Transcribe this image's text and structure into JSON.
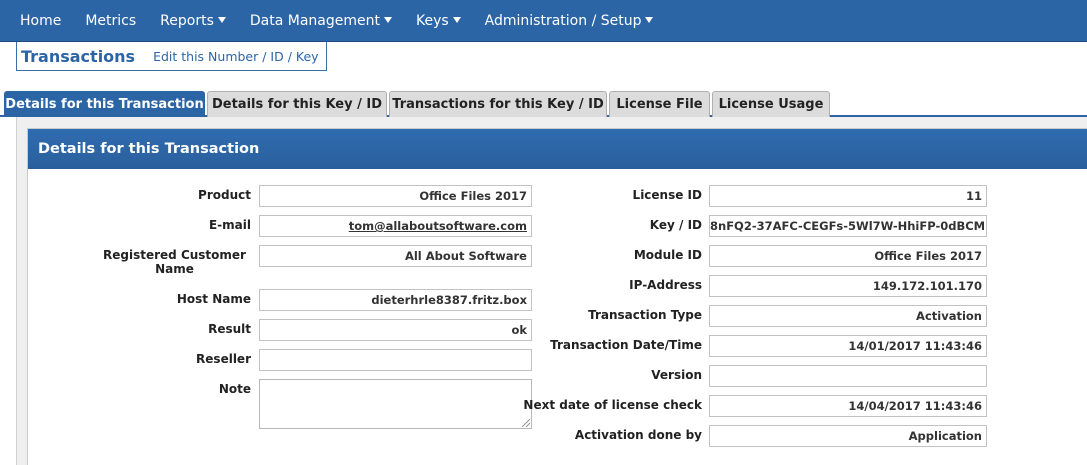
{
  "nav": {
    "items": [
      {
        "label": "Home",
        "dropdown": false
      },
      {
        "label": "Metrics",
        "dropdown": false
      },
      {
        "label": "Reports",
        "dropdown": true
      },
      {
        "label": "Data Management",
        "dropdown": true
      },
      {
        "label": "Keys",
        "dropdown": true
      },
      {
        "label": "Administration / Setup",
        "dropdown": true
      }
    ]
  },
  "header": {
    "title": "Transactions",
    "edit_link": "Edit this Number / ID / Key"
  },
  "tabs": [
    {
      "label": "Details for this Transaction",
      "active": true
    },
    {
      "label": "Details for this Key / ID",
      "active": false
    },
    {
      "label": "Transactions for this Key / ID",
      "active": false
    },
    {
      "label": "License File",
      "active": false
    },
    {
      "label": "License Usage",
      "active": false
    }
  ],
  "panel": {
    "title": "Details for this Transaction",
    "left": [
      {
        "label": "Product",
        "value": "Office Files 2017"
      },
      {
        "label": "E-mail",
        "value": "tom@allaboutsoftware.com"
      },
      {
        "label": "Registered Customer Name",
        "value": "All About Software"
      },
      {
        "label": "Host Name",
        "value": "dieterhrle8387.fritz.box"
      },
      {
        "label": "Result",
        "value": "ok"
      },
      {
        "label": "Reseller",
        "value": ""
      },
      {
        "label": "Note",
        "value": ""
      }
    ],
    "right": [
      {
        "label": "License ID",
        "value": "11"
      },
      {
        "label": "Key / ID",
        "value": "8nFQ2-37AFC-CEGFs-5Wl7W-HhiFP-0dBCM"
      },
      {
        "label": "Module ID",
        "value": "Office Files 2017"
      },
      {
        "label": "IP-Address",
        "value": "149.172.101.170"
      },
      {
        "label": "Transaction Type",
        "value": "Activation"
      },
      {
        "label": "Transaction Date/Time",
        "value": "14/01/2017 11:43:46"
      },
      {
        "label": "Version",
        "value": ""
      },
      {
        "label": "Next date of license check",
        "value": "14/04/2017 11:43:46"
      },
      {
        "label": "Activation done by",
        "value": "Application"
      }
    ]
  },
  "colors": {
    "nav_bg": "#2c65a6",
    "accent": "#2c65a6",
    "tab_inactive": "#dcdcdc"
  }
}
